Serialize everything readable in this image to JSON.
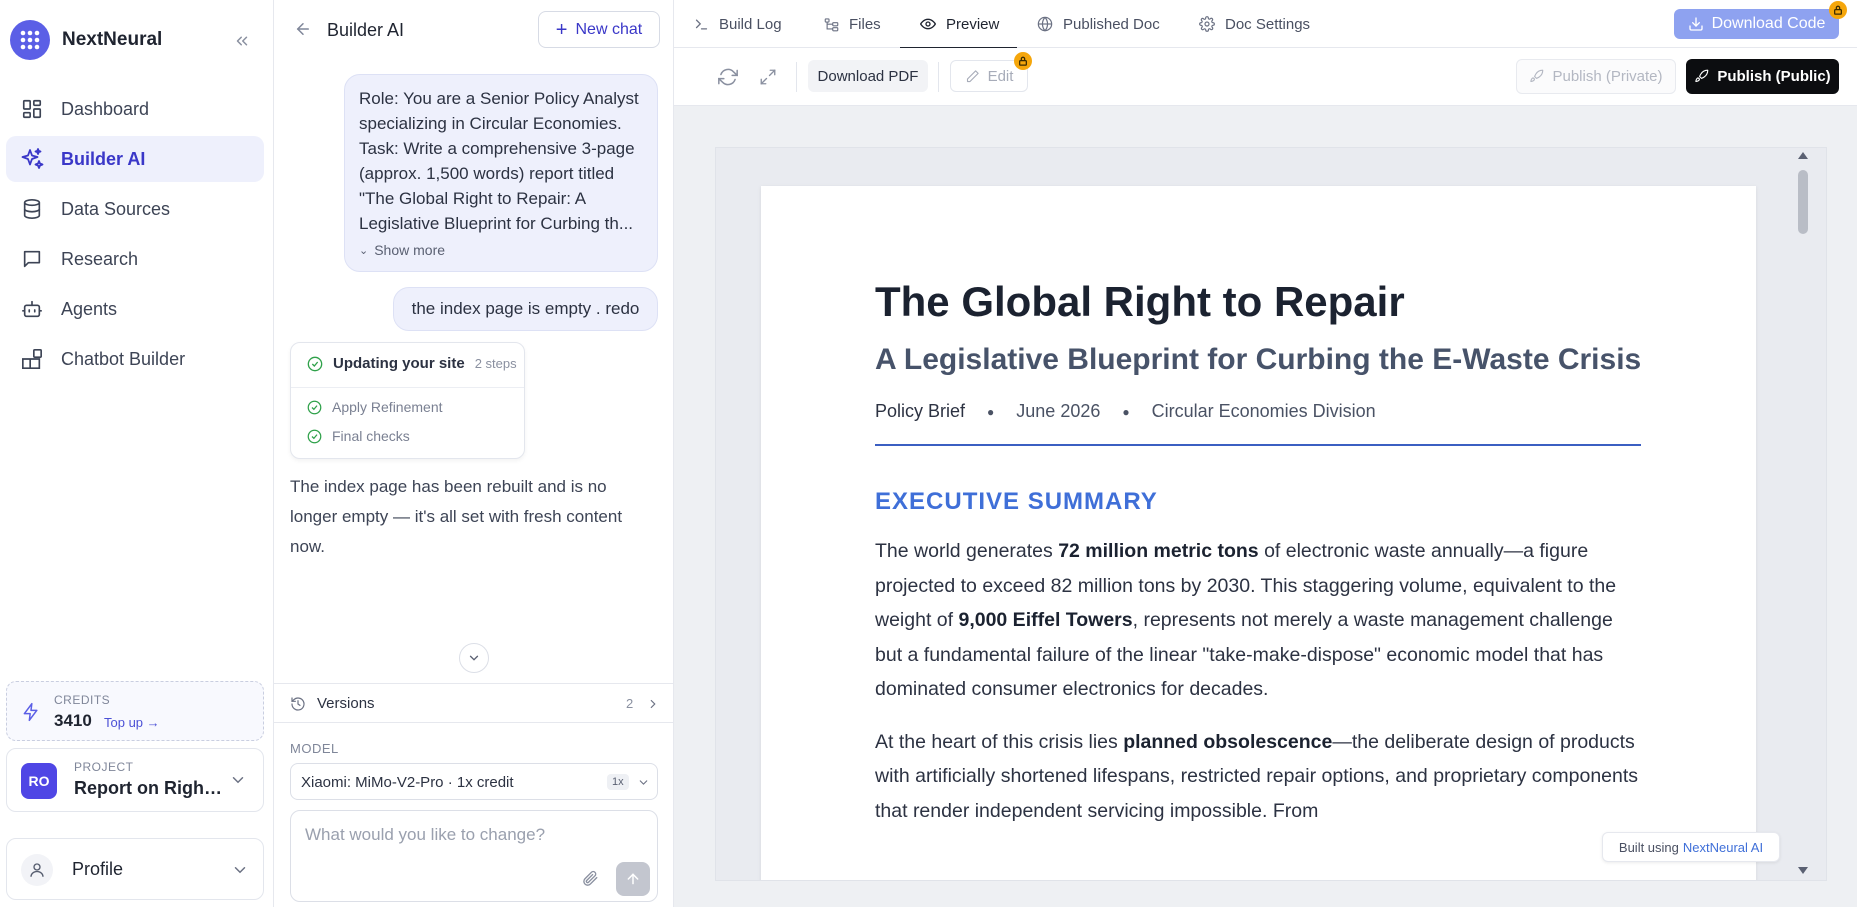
{
  "sidebar": {
    "brand": "NextNeural",
    "nav": [
      {
        "label": "Dashboard",
        "icon": "dashboard-icon"
      },
      {
        "label": "Builder AI",
        "icon": "sparkles-icon",
        "active": true
      },
      {
        "label": "Data Sources",
        "icon": "database-icon"
      },
      {
        "label": "Research",
        "icon": "message-square-icon"
      },
      {
        "label": "Agents",
        "icon": "bot-icon"
      },
      {
        "label": "Chatbot Builder",
        "icon": "blocks-icon"
      }
    ],
    "credits": {
      "label": "CREDITS",
      "value": "3410",
      "topup": "Top up →"
    },
    "project": {
      "label": "PROJECT",
      "avatar": "RO",
      "name": "Report on Right..."
    },
    "profile": {
      "label": "Profile"
    }
  },
  "chat": {
    "title": "Builder AI",
    "new_chat": "New chat",
    "messages": {
      "user1": "Role: You are a Senior Policy Analyst specializing in Circular Economies. Task: Write a comprehensive 3-page (approx. 1,500 words) report titled \"The Global Right to Repair: A Legislative Blueprint for Curbing th...",
      "show_more": "Show more",
      "user2": "the index page is empty . redo",
      "steps": {
        "title": "Updating your site",
        "count": "2 steps",
        "items": [
          "Apply Refinement",
          "Final checks"
        ]
      },
      "ai": "The index page has been rebuilt and is no longer empty — it's all set with fresh content now."
    },
    "versions": {
      "label": "Versions",
      "count": "2"
    },
    "model": {
      "label": "MODEL",
      "value": "Xiaomi: MiMo-V2-Pro · 1x credit",
      "badge": "1x"
    },
    "prompt": {
      "placeholder": "What would you like to change?"
    }
  },
  "main": {
    "tabs": [
      {
        "label": "Build Log",
        "icon": "terminal-icon"
      },
      {
        "label": "Files",
        "icon": "folder-tree-icon"
      },
      {
        "label": "Preview",
        "icon": "eye-icon",
        "active": true
      },
      {
        "label": "Published Doc",
        "icon": "globe-icon"
      },
      {
        "label": "Doc Settings",
        "icon": "gear-icon"
      }
    ],
    "download_code": "Download Code",
    "toolbar": {
      "download_pdf": "Download PDF",
      "edit": "Edit",
      "publish_private": "Publish (Private)",
      "publish_public": "Publish (Public)"
    },
    "document": {
      "title": "The Global Right to Repair",
      "subtitle": "A Legislative Blueprint for Curbing the E-Waste Crisis",
      "meta": {
        "type": "Policy Brief",
        "date": "June 2026",
        "division": "Circular Economies Division"
      },
      "section_heading": "EXECUTIVE SUMMARY",
      "p1": {
        "a": "The world generates ",
        "b1": "72 million metric tons",
        "c": " of electronic waste annually—a figure projected to exceed 82 million tons by 2030. This staggering volume, equivalent to the weight of ",
        "b2": "9,000 Eiffel Towers",
        "d": ", represents not merely a waste management challenge but a fundamental failure of the linear \"take-make-dispose\" economic model that has dominated consumer electronics for decades."
      },
      "p2": {
        "a": "At the heart of this crisis lies ",
        "b1": "planned obsolescence",
        "c": "—the deliberate design of products with artificially shortened lifespans, restricted repair options, and proprietary components that render independent servicing impossible. From"
      }
    },
    "built_using": {
      "prefix": "Built using",
      "brand": "NextNeural AI"
    }
  },
  "colors": {
    "accent": "#5b5fe6",
    "link": "#3f6fd8",
    "lock": "#f5a60b",
    "publish_public": "#0c0d10"
  }
}
